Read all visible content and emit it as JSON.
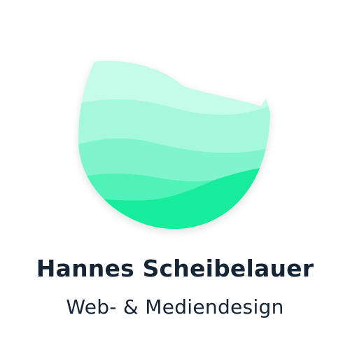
{
  "brand": {
    "name": "Hannes Scheibelauer",
    "tagline": "Web- & Mediendesign"
  },
  "logo": {
    "icon": "wave-globe-logo-icon",
    "colors": {
      "wave_top": "#c5fbe9",
      "wave_upper": "#a6f8dd",
      "wave_middle": "#80f5cd",
      "wave_lower": "#4ff2b9",
      "wave_bottom": "#14ec9c"
    }
  },
  "colors": {
    "text": "#152536",
    "background": "#ffffff"
  }
}
